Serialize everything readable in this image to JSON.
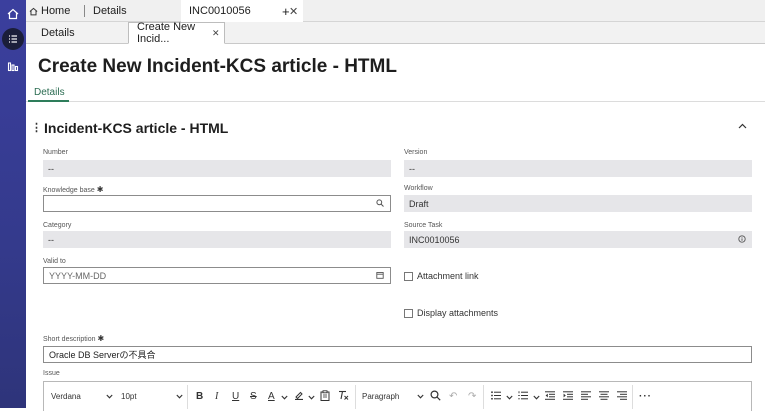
{
  "top_tabs": [
    {
      "label": "Home"
    },
    {
      "label": "Details"
    },
    {
      "label": "INC0010056"
    }
  ],
  "add_tab_symbol": "+",
  "sub_tabs": [
    {
      "label": "Details"
    },
    {
      "label": "Create New Incid..."
    }
  ],
  "page_title": "Create New Incident-KCS article - HTML",
  "form_tab": "Details",
  "section_title": "Incident-KCS article - HTML",
  "fields": {
    "number": {
      "label": "Number",
      "value": "--"
    },
    "version": {
      "label": "Version",
      "value": "--"
    },
    "knowledge_base": {
      "label": "Knowledge base",
      "value": ""
    },
    "workflow": {
      "label": "Workflow",
      "value": "Draft"
    },
    "category": {
      "label": "Category",
      "value": "--"
    },
    "source_task": {
      "label": "Source Task",
      "value": "INC0010056"
    },
    "valid_to": {
      "label": "Valid to",
      "placeholder": "YYYY-MM-DD"
    },
    "attachment_link": {
      "label": "Attachment link",
      "checked": false
    },
    "display_attachments": {
      "label": "Display attachments",
      "checked": false
    },
    "short_description": {
      "label": "Short description",
      "value": "Oracle DB Serverの不具合"
    },
    "issue": {
      "label": "Issue"
    }
  },
  "required_mark": "✱",
  "editor": {
    "font": "Verdana",
    "size": "10pt",
    "block": "Paragraph"
  }
}
